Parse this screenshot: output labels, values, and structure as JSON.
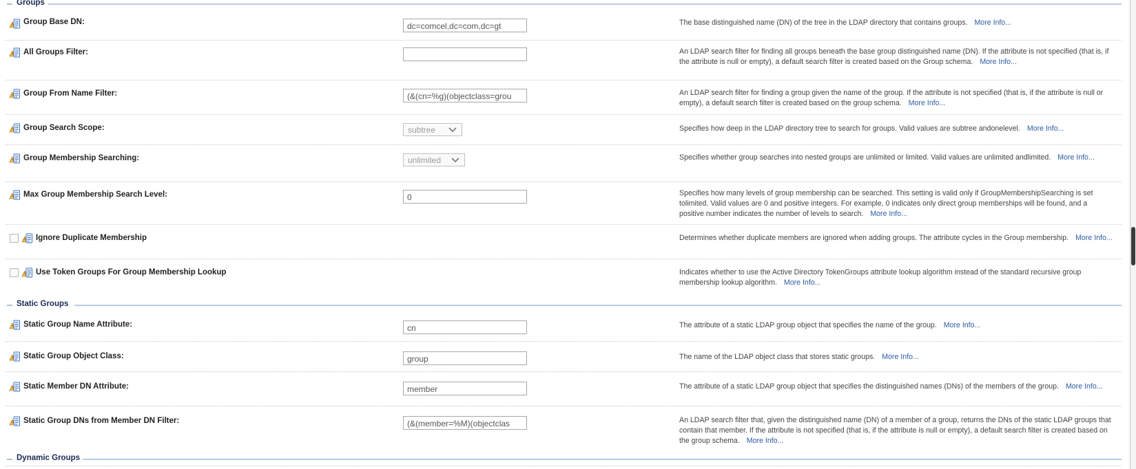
{
  "sections": {
    "groups": "Groups",
    "static_groups": "Static Groups",
    "dynamic_groups": "Dynamic Groups"
  },
  "more_info": "More Info...",
  "rows": [
    {
      "label": "Group Base DN:",
      "value": "dc=comcel,dc=com,dc=gt",
      "desc": "The base distinguished name (DN) of the tree in the LDAP directory that contains groups."
    },
    {
      "label": "All Groups Filter:",
      "value": "",
      "desc": "An LDAP search filter for finding all groups beneath the base group distinguished name (DN). If the attribute is not specified (that is, if the attribute is null or empty), a default search filter is created based on the Group schema."
    },
    {
      "label": "Group From Name Filter:",
      "value": "(&(cn=%g)(objectclass=grou",
      "desc": "An LDAP search filter for finding a group given the name of the group. If the attribute is not specified (that is, if the attribute is null or empty), a default search filter is created based on the group schema."
    },
    {
      "label": "Group Search Scope:",
      "value": "subtree",
      "desc": "Specifies how deep in the LDAP directory tree to search for groups. Valid values are subtree andonelevel."
    },
    {
      "label": "Group Membership Searching:",
      "value": "unlimited",
      "desc": "Specifies whether group searches into nested groups are unlimited or limited. Valid values are unlimited andlimited."
    },
    {
      "label": "Max Group Membership Search Level:",
      "value": "0",
      "desc": "Specifies how many levels of group membership can be searched. This setting is valid only if GroupMembershipSearching is set tolimited. Valid values are 0 and positive integers. For example, 0 indicates only direct group memberships will be found, and a positive number indicates the number of levels to search."
    },
    {
      "label": "Ignore Duplicate Membership",
      "checked": false,
      "desc": "Determines whether duplicate members are ignored when adding groups. The attribute cycles in the Group membership."
    },
    {
      "label": "Use Token Groups For Group Membership Lookup",
      "checked": false,
      "desc": "Indicates whether to use the Active Directory TokenGroups attribute lookup algorithm instead of the standard recursive group membership lookup algorithm."
    },
    {
      "label": "Static Group Name Attribute:",
      "value": "cn",
      "desc": "The attribute of a static LDAP group object that specifies the name of the group."
    },
    {
      "label": "Static Group Object Class:",
      "value": "group",
      "desc": "The name of the LDAP object class that stores static groups."
    },
    {
      "label": "Static Member DN Attribute:",
      "value": "member",
      "desc": "The attribute of a static LDAP group object that specifies the distinguished names (DNs) of the members of the group."
    },
    {
      "label": "Static Group DNs from Member DN Filter:",
      "value": "(&(member=%M)(objectclas",
      "desc": "An LDAP search filter that, given the distinguished name (DN) of a member of a group, returns the DNs of the static LDAP groups that contain that member. If the attribute is not specified (that is, if the attribute is null or empty), a default search filter is created based on the group schema."
    }
  ]
}
